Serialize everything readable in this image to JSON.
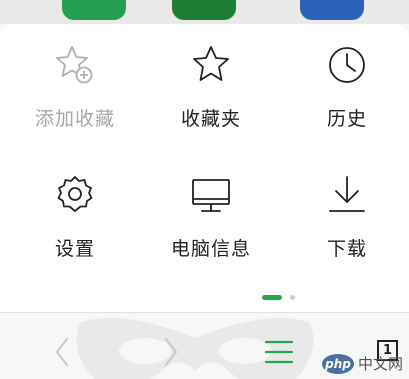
{
  "colors": {
    "accent": "#21a84a",
    "disabled": "#a8a8a8",
    "text": "#222222"
  },
  "menu": {
    "items": [
      {
        "label": "添加收藏",
        "icon": "star-plus-icon",
        "enabled": false
      },
      {
        "label": "收藏夹",
        "icon": "star-icon",
        "enabled": true
      },
      {
        "label": "历史",
        "icon": "clock-icon",
        "enabled": true
      },
      {
        "label": "设置",
        "icon": "gear-icon",
        "enabled": true
      },
      {
        "label": "电脑信息",
        "icon": "monitor-icon",
        "enabled": true
      },
      {
        "label": "下载",
        "icon": "download-icon",
        "enabled": true
      }
    ],
    "page_indicator": {
      "current": 1,
      "total": 2
    }
  },
  "bottom_bar": {
    "back_icon": "chevron-left-icon",
    "forward_icon": "chevron-right-icon",
    "menu_icon": "hamburger-menu-icon",
    "tab_count": "1"
  },
  "watermark": {
    "logo": "php",
    "text": "中文网"
  }
}
